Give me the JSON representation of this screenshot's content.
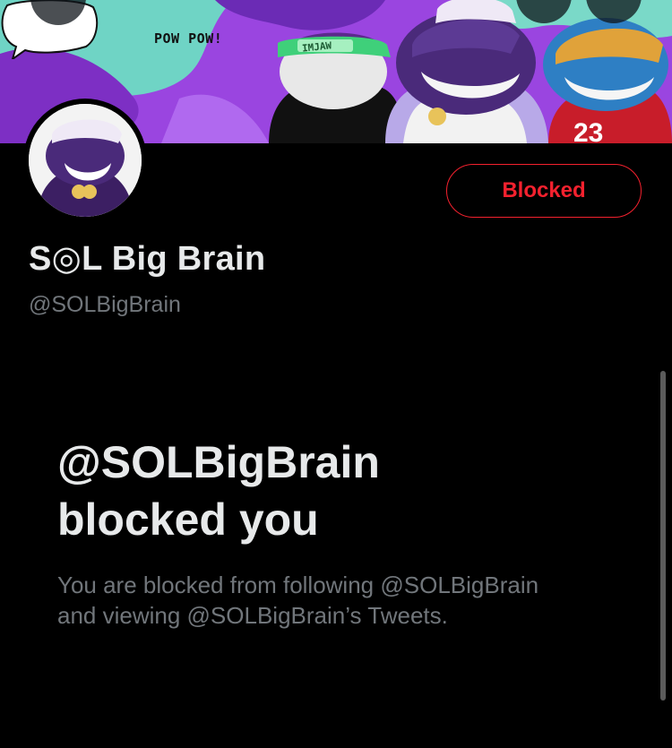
{
  "banner": {
    "speech_text": "POW POW!",
    "visor_text": "IMJAW",
    "jersey_number": "23"
  },
  "profile": {
    "display_name": "S◎L Big Brain",
    "handle": "@SOLBigBrain",
    "blocked_button_label": "Blocked"
  },
  "notice": {
    "title_line1": "@SOLBigBrain",
    "title_line2": "blocked you",
    "body_line1": "You are blocked from following @SOLBigBrain",
    "body_line2": "and viewing @SOLBigBrain’s Tweets."
  },
  "colors": {
    "background": "#000000",
    "blocked_red": "#f4212e",
    "secondary_text": "#71767b",
    "primary_text": "#e7e9ea"
  },
  "icons": [
    "back-arrow-icon",
    "search-icon",
    "more-options-icon"
  ]
}
